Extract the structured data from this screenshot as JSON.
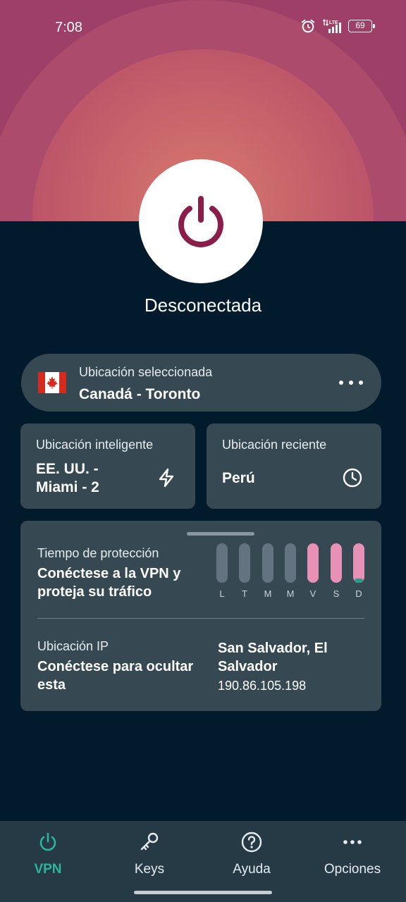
{
  "status_bar": {
    "time": "7:08",
    "network": "LTE",
    "battery": "69",
    "icons": [
      "alarm-icon",
      "signal-icon",
      "battery-icon"
    ]
  },
  "connection": {
    "status": "Desconectada",
    "power_icon": "power-icon"
  },
  "selected_location": {
    "label": "Ubicación seleccionada",
    "value": "Canadá - Toronto",
    "flag": "canada-flag-icon",
    "menu_icon": "more-horizontal-icon"
  },
  "smart_location": {
    "label": "Ubicación inteligente",
    "value": "EE. UU. - Miami - 2",
    "icon": "lightning-icon"
  },
  "recent_location": {
    "label": "Ubicación reciente",
    "value": "Perú",
    "icon": "clock-icon"
  },
  "protection": {
    "label": "Tiempo de protección",
    "value": "Conéctese a la VPN y proteja su tráfico",
    "days": [
      {
        "day": "L",
        "active": false,
        "level": 0
      },
      {
        "day": "T",
        "active": false,
        "level": 0
      },
      {
        "day": "M",
        "active": false,
        "level": 0
      },
      {
        "day": "M",
        "active": false,
        "level": 0
      },
      {
        "day": "V",
        "active": true,
        "level": 0
      },
      {
        "day": "S",
        "active": true,
        "level": 0
      },
      {
        "day": "D",
        "active": true,
        "level": 0.1
      }
    ]
  },
  "ip_location": {
    "label": "Ubicación IP",
    "value": "Conéctese para ocultar esta",
    "city": "San Salvador, El Salvador",
    "ip": "190.86.105.198"
  },
  "nav": {
    "items": [
      {
        "label": "VPN",
        "icon": "power-icon",
        "active": true
      },
      {
        "label": "Keys",
        "icon": "key-icon",
        "active": false
      },
      {
        "label": "Ayuda",
        "icon": "help-icon",
        "active": false
      },
      {
        "label": "Opciones",
        "icon": "more-horizontal-icon",
        "active": false
      }
    ]
  },
  "colors": {
    "background": "#011b2d",
    "card": "#364953",
    "accent_teal": "#2bb59c",
    "power_maroon": "#8b1d4a",
    "bar_active": "#e791b6",
    "bar_inactive": "#637480"
  }
}
